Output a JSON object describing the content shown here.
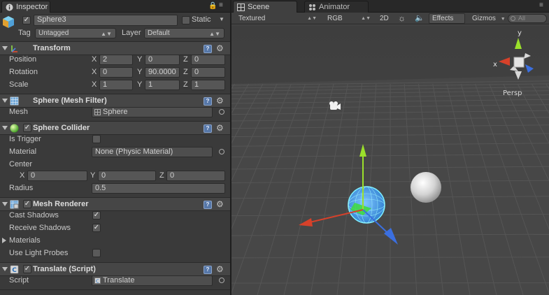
{
  "inspector": {
    "tab_label": "Inspector",
    "object": {
      "enabled": true,
      "name": "Sphere3",
      "static_label": "Static",
      "static_checked": false,
      "tag_label": "Tag",
      "tag_value": "Untagged",
      "layer_label": "Layer",
      "layer_value": "Default"
    },
    "transform": {
      "title": "Transform",
      "position_label": "Position",
      "rotation_label": "Rotation",
      "scale_label": "Scale",
      "x_label": "X",
      "y_label": "Y",
      "z_label": "Z",
      "position": {
        "x": "2",
        "y": "0",
        "z": "0"
      },
      "rotation": {
        "x": "0",
        "y": "90.0000",
        "z": "0"
      },
      "scale": {
        "x": "1",
        "y": "1",
        "z": "1"
      }
    },
    "mesh_filter": {
      "title": "Sphere (Mesh Filter)",
      "mesh_label": "Mesh",
      "mesh_value": "Sphere"
    },
    "sphere_collider": {
      "title": "Sphere Collider",
      "enabled": true,
      "is_trigger_label": "Is Trigger",
      "is_trigger": false,
      "material_label": "Material",
      "material_value": "None (Physic Material)",
      "center_label": "Center",
      "center": {
        "x": "0",
        "y": "0",
        "z": "0"
      },
      "radius_label": "Radius",
      "radius_value": "0.5"
    },
    "mesh_renderer": {
      "title": "Mesh Renderer",
      "enabled": true,
      "cast_shadows_label": "Cast Shadows",
      "cast_shadows": true,
      "receive_shadows_label": "Receive Shadows",
      "receive_shadows": true,
      "materials_label": "Materials",
      "use_light_probes_label": "Use Light Probes",
      "use_light_probes": false
    },
    "translate_script": {
      "title": "Translate (Script)",
      "enabled": true,
      "script_label": "Script",
      "script_value": "Translate"
    }
  },
  "scene": {
    "tab_label": "Scene",
    "animator_tab_label": "Animator",
    "toolbar": {
      "render_mode": "Textured",
      "color_mode": "RGB",
      "mode_2d": "2D",
      "effects": "Effects",
      "gizmos": "Gizmos",
      "search_placeholder": "All"
    },
    "gizmo": {
      "x_label": "x",
      "y_label": "y",
      "projection": "Persp"
    }
  },
  "colors": {
    "x_axis": "#d7412a",
    "y_axis": "#9be02b",
    "z_axis": "#3b6fe0",
    "collider": "#7ff0ff",
    "panel": "#3a3a3a",
    "scene_bg": "#4a4a4a"
  },
  "icons": {
    "inspector_tab": "info-icon",
    "lock": "lock-icon",
    "transform": "transform-icon",
    "mesh_filter": "mesh-filter-icon",
    "sphere_collider": "sphere-collider-icon",
    "mesh_renderer": "mesh-renderer-icon",
    "script": "script-icon",
    "help": "help-icon",
    "settings": "gear-icon",
    "light": "sun-icon",
    "audio": "speaker-icon",
    "camera": "camera-icon"
  }
}
